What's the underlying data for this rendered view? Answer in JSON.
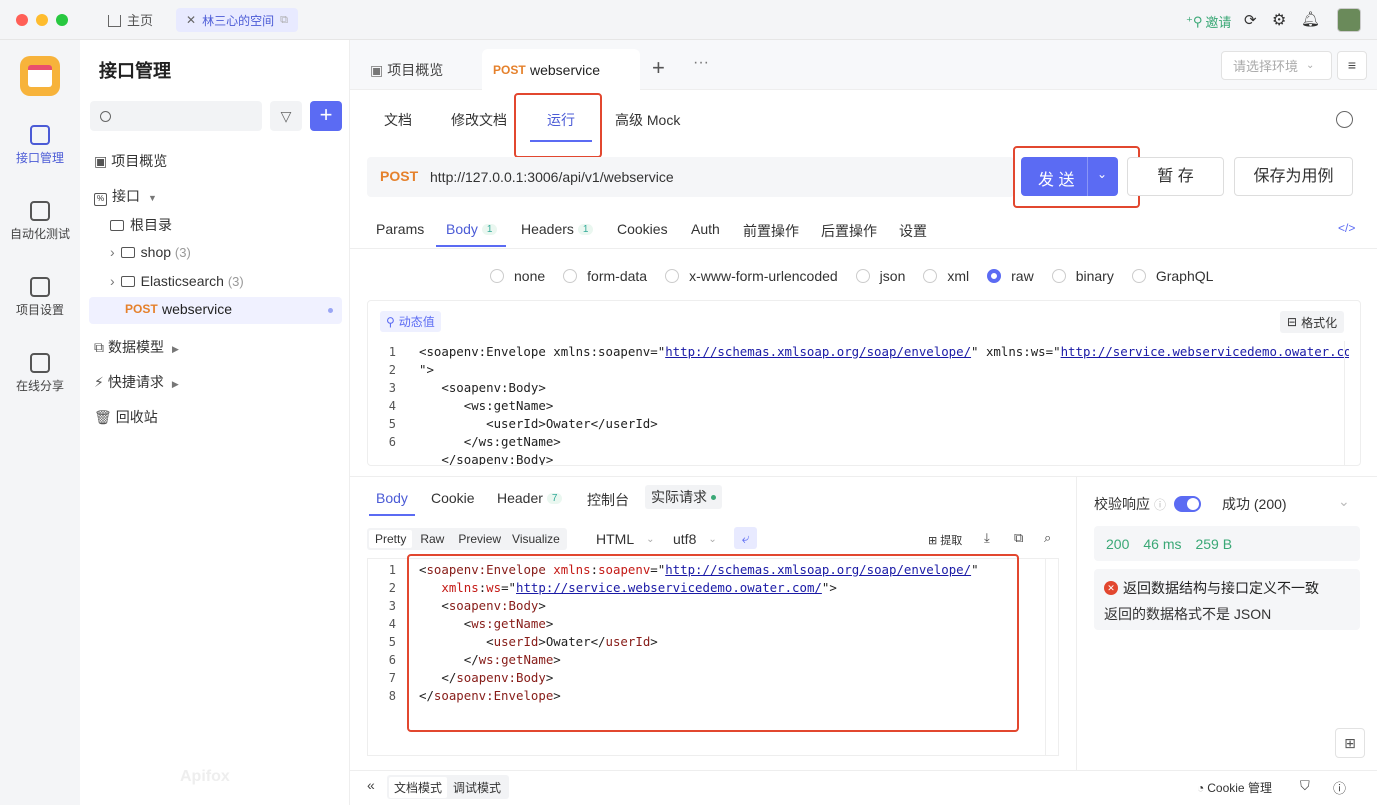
{
  "titlebar": {
    "home_label": "主页",
    "space_tab_label": "林三心的空间",
    "invite_label": "邀请"
  },
  "rail": {
    "items": [
      {
        "label": "接口管理"
      },
      {
        "label": "自动化测试"
      },
      {
        "label": "项目设置"
      },
      {
        "label": "在线分享"
      }
    ],
    "brand": "Apifox"
  },
  "sidebar": {
    "title": "接口管理",
    "search_placeholder": "",
    "overview": "项目概览",
    "api_label": "接口",
    "root_dir": "根目录",
    "folders": [
      {
        "name": "shop",
        "count": "(3)"
      },
      {
        "name": "Elasticsearch",
        "count": "(3)"
      }
    ],
    "active_item": {
      "method": "POST",
      "name": "webservice"
    },
    "data_model": "数据模型",
    "quick_request": "快捷请求",
    "recycle": "回收站"
  },
  "main_tabs": {
    "overview_tab": "项目概览",
    "active_method": "POST",
    "active_name": "webservice",
    "env_placeholder": "请选择环境"
  },
  "subtabs": [
    "文档",
    "修改文档",
    "运行",
    "高级 Mock"
  ],
  "request": {
    "method": "POST",
    "url": "http://127.0.0.1:3006/api/v1/webservice",
    "send": "发 送",
    "save_temp": "暂 存",
    "save_case": "保存为用例"
  },
  "param_tabs": [
    {
      "label": "Params",
      "badge": ""
    },
    {
      "label": "Body",
      "badge": "1"
    },
    {
      "label": "Headers",
      "badge": "1"
    },
    {
      "label": "Cookies",
      "badge": ""
    },
    {
      "label": "Auth",
      "badge": ""
    },
    {
      "label": "前置操作",
      "badge": ""
    },
    {
      "label": "后置操作",
      "badge": ""
    },
    {
      "label": "设置",
      "badge": ""
    }
  ],
  "body_types": [
    "none",
    "form-data",
    "x-www-form-urlencoded",
    "json",
    "xml",
    "raw",
    "binary",
    "GraphQL"
  ],
  "body_selected": "raw",
  "editor": {
    "dynamic_value": "动态值",
    "format": "格式化",
    "lines": [
      "1",
      "",
      "2",
      "3",
      "4",
      "5",
      "6"
    ]
  },
  "resp_tabs": [
    {
      "label": "Body"
    },
    {
      "label": "Cookie"
    },
    {
      "label": "Header",
      "badge": "7"
    },
    {
      "label": "控制台"
    },
    {
      "label": "实际请求"
    }
  ],
  "resp_toolbar": {
    "views": [
      "Pretty",
      "Raw",
      "Preview",
      "Visualize"
    ],
    "format": "HTML",
    "encoding": "utf8",
    "extract": "提取"
  },
  "resp_lines": [
    "1",
    "2",
    "3",
    "4",
    "5",
    "6",
    "7",
    "8"
  ],
  "validate": {
    "label": "校验响应",
    "status_select": "成功 (200)",
    "code": "200",
    "time": "46 ms",
    "size": "259 B",
    "error_title": "返回数据结构与接口定义不一致",
    "error_detail": "返回的数据格式不是 JSON"
  },
  "footer": {
    "doc_mode": "文档模式",
    "debug_mode": "调试模式",
    "cookie_mgr": "Cookie 管理"
  },
  "colors": {
    "accent": "#5b6bf3",
    "post": "#e5812c",
    "highlight_red": "#e2472f",
    "success": "#3aa876"
  }
}
